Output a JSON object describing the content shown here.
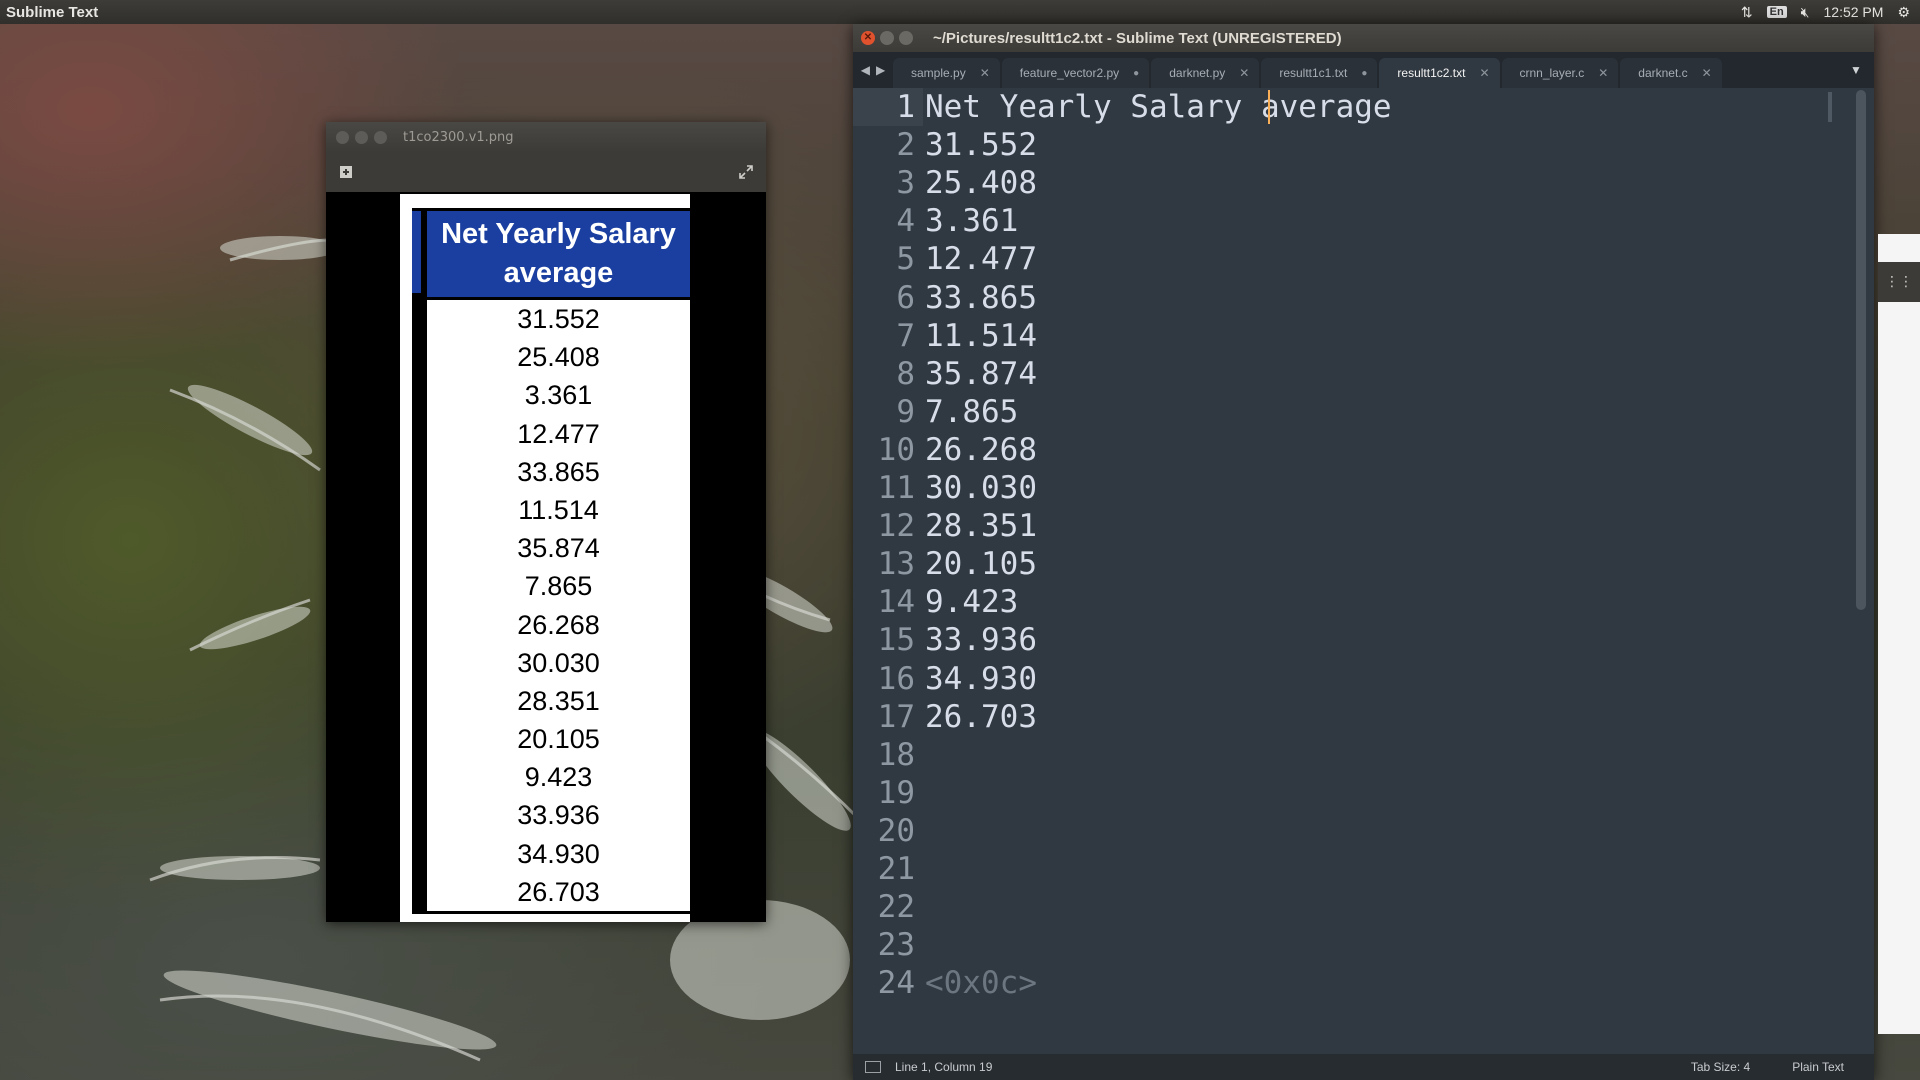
{
  "top_panel": {
    "app_name": "Sublime Text",
    "keyboard_layout": "En",
    "clock": "12:52 PM",
    "icons": [
      "network-icon",
      "keyboard-icon",
      "volume-muted-icon",
      "settings-gear-icon"
    ]
  },
  "image_viewer": {
    "title": "t1co2300.v1.png",
    "table": {
      "header": "Net Yearly Salary average",
      "rows": [
        "31.552",
        "25.408",
        "3.361",
        "12.477",
        "33.865",
        "11.514",
        "35.874",
        "7.865",
        "26.268",
        "30.030",
        "28.351",
        "20.105",
        "9.423",
        "33.936",
        "34.930",
        "26.703"
      ]
    }
  },
  "sublime": {
    "window_title": "~/Pictures/resultt1c2.txt - Sublime Text (UNREGISTERED)",
    "tabs": [
      {
        "label": "sample.py",
        "state": "close"
      },
      {
        "label": "feature_vector2.py",
        "state": "dirty"
      },
      {
        "label": "darknet.py",
        "state": "close"
      },
      {
        "label": "resultt1c1.txt",
        "state": "dirty"
      },
      {
        "label": "resultt1c2.txt",
        "state": "close",
        "active": true
      },
      {
        "label": "crnn_layer.c",
        "state": "close"
      },
      {
        "label": "darknet.c",
        "state": "close"
      }
    ],
    "lines": [
      "Net Yearly Salary average",
      "31.552",
      "25.408",
      "3.361",
      "12.477",
      "33.865",
      "11.514",
      "35.874",
      "7.865",
      "26.268",
      "30.030",
      "28.351",
      "20.105",
      "9.423",
      "33.936",
      "34.930",
      "26.703",
      "",
      "",
      "",
      "",
      "",
      "",
      "<0x0c>"
    ],
    "status": {
      "position": "Line 1, Column 19",
      "tab_size": "Tab Size: 4",
      "syntax": "Plain Text"
    }
  },
  "colors": {
    "editor_bg": "#303841",
    "caret": "#f9ae58",
    "table_header_bg": "#1a3fa0"
  }
}
